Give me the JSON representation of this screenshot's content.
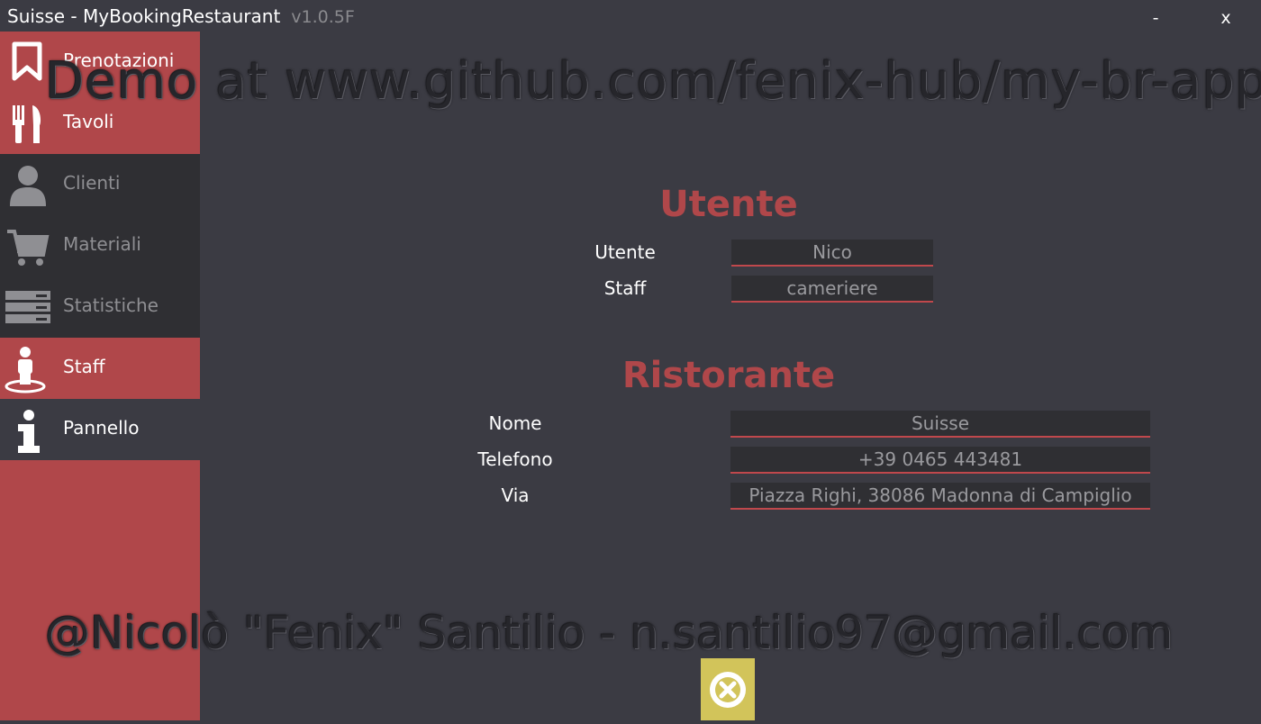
{
  "window": {
    "title": "Suisse - MyBookingRestaurant",
    "version": "v1.0.5F",
    "minimize_label": "-",
    "close_label": "x"
  },
  "sidebar": {
    "items": [
      {
        "label": "Prenotazioni",
        "icon": "bookmark-icon"
      },
      {
        "label": "Tavoli",
        "icon": "fork-knife-icon"
      },
      {
        "label": "Clienti",
        "icon": "user-icon"
      },
      {
        "label": "Materiali",
        "icon": "cart-icon"
      },
      {
        "label": "Statistiche",
        "icon": "server-rack-icon"
      },
      {
        "label": "Staff",
        "icon": "staff-icon"
      },
      {
        "label": "Pannello",
        "icon": "info-icon"
      }
    ],
    "active": "Pannello"
  },
  "watermark": {
    "top": "Demo   at   www.github.com/fenix-hub/my-br-app",
    "bottom": "@Nicolò \"Fenix\" Santilio - n.santilio97@gmail.com"
  },
  "utente": {
    "title": "Utente",
    "user_label": "Utente",
    "user_value": "Nico",
    "staff_label": "Staff",
    "staff_value": "cameriere"
  },
  "ristorante": {
    "title": "Ristorante",
    "name_label": "Nome",
    "name_value": "Suisse",
    "phone_label": "Telefono",
    "phone_value": "+39 0465 443481",
    "address_label": "Via",
    "address_value": "Piazza Righi, 38086 Madonna di Campiglio"
  },
  "close_button": {
    "icon": "close-circle-icon"
  },
  "colors": {
    "accent": "#b0474a",
    "background": "#3b3b43",
    "sidebar_dark": "#2f2f33",
    "close_button": "#d2c45a"
  }
}
